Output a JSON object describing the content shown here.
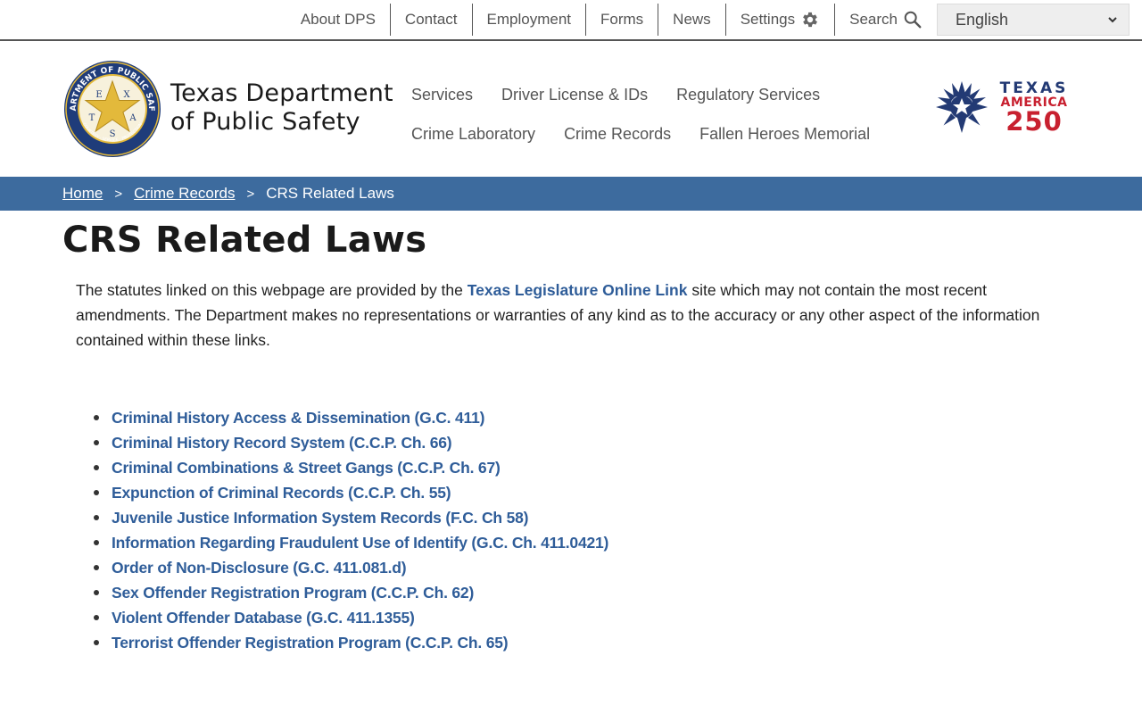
{
  "utility": {
    "links": [
      "About DPS",
      "Contact",
      "Employment",
      "Forms",
      "News"
    ],
    "settings_label": "Settings",
    "search_label": "Search",
    "language": "English"
  },
  "header": {
    "agency_line1": "Texas Department",
    "agency_line2": "of Public Safety",
    "seal_text": {
      "ring_top": "DEPARTMENT OF PUBLIC SAFETY",
      "ring_bottom": "COURTESY · SERVICE · PROTECTION",
      "letters": [
        "T",
        "E",
        "X",
        "A",
        "S"
      ]
    },
    "badge": {
      "line1": "TEXAS",
      "line2": "AMERICA",
      "line3": "250"
    },
    "nav_row1": [
      "Services",
      "Driver License & IDs",
      "Regulatory Services"
    ],
    "nav_row2": [
      "Crime Laboratory",
      "Crime Records",
      "Fallen Heroes Memorial"
    ]
  },
  "breadcrumb": {
    "home": "Home",
    "parent": "Crime Records",
    "current": "CRS Related Laws",
    "separator": ">"
  },
  "main": {
    "title": "CRS Related Laws",
    "intro_before": "The statutes linked on this webpage are provided by the ",
    "intro_link": "Texas Legislature Online Link",
    "intro_after": " site which may not contain the most recent amendments. The Department makes no representations or warranties of any kind as to the accuracy or any other aspect of the information contained within these links.",
    "laws": [
      "Criminal History Access & Dissemination (G.C. 411)",
      "Criminal History Record System (C.C.P. Ch. 66)",
      "Criminal Combinations & Street Gangs (C.C.P. Ch. 67)",
      "Expunction of Criminal Records (C.C.P. Ch. 55)",
      "Juvenile Justice Information System Records (F.C. Ch 58)",
      "Information Regarding Fraudulent Use of Identify (G.C. Ch. 411.0421)",
      "Order of Non-Disclosure (G.C. 411.081.d)",
      "Sex Offender Registration Program (C.C.P. Ch. 62)",
      "Violent Offender Database (G.C. 411.1355)",
      "Terrorist Offender Registration Program (C.C.P. Ch. 65)"
    ]
  },
  "colors": {
    "breadcrumb_bg": "#3d6b9e",
    "link": "#2f5d99",
    "seal_navy": "#1f3c7a",
    "seal_gold": "#e3b93b",
    "badge_navy": "#233a74",
    "badge_red": "#c8202f"
  }
}
